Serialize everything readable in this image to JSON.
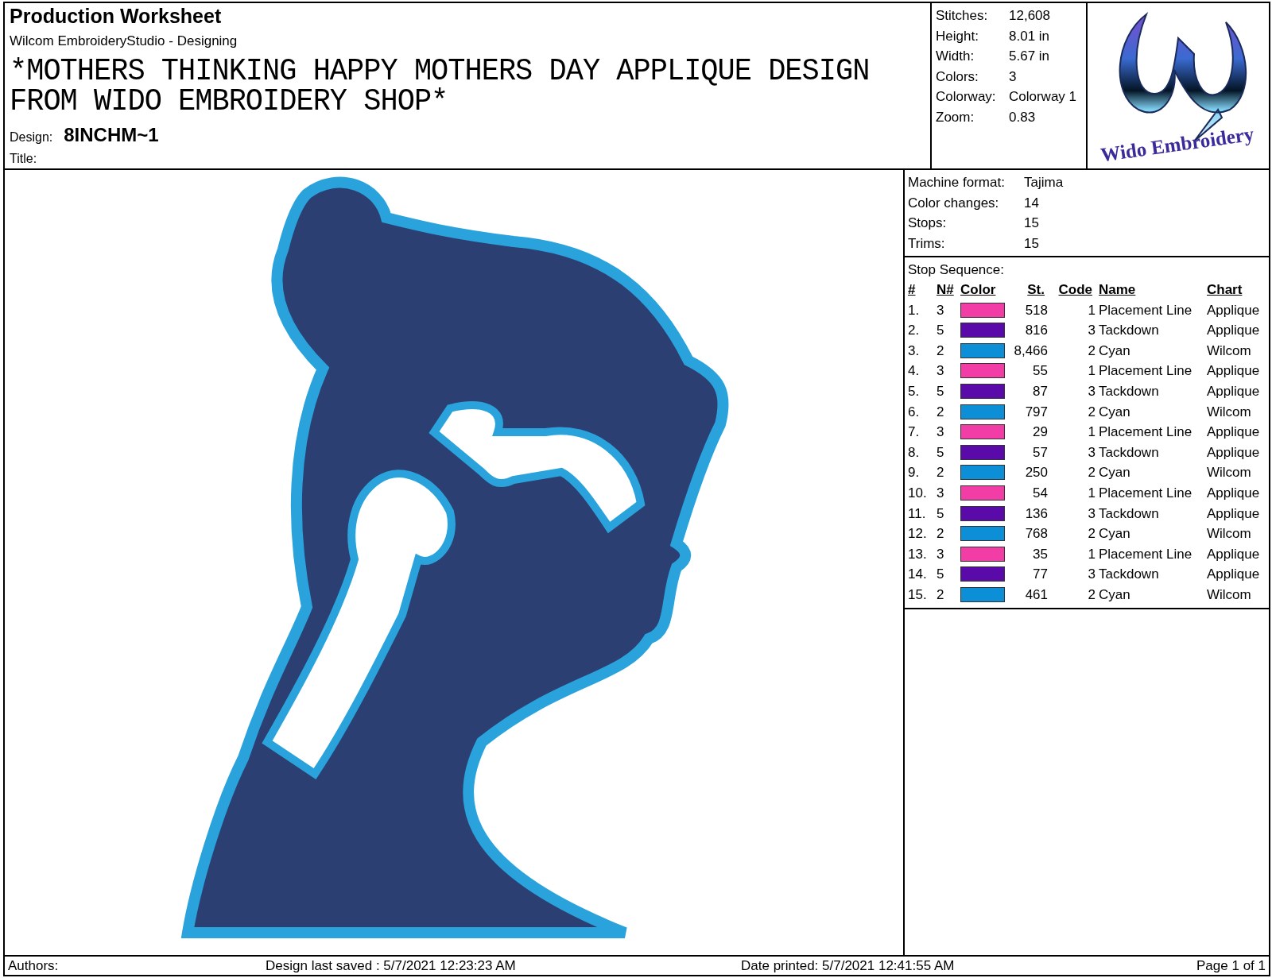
{
  "header": {
    "title": "Production Worksheet",
    "subtitle": "Wilcom EmbroideryStudio - Designing",
    "design_description": "*MOTHERS THINKING HAPPY MOTHERS DAY APPLIQUE DESIGN FROM WIDO EMBROIDERY SHOP*",
    "design_label": "Design:",
    "design_value": "8INCHM~1",
    "title_label": "Title:"
  },
  "stats": [
    {
      "label": "Stitches:",
      "value": "12,608"
    },
    {
      "label": "Height:",
      "value": "8.01 in"
    },
    {
      "label": "Width:",
      "value": "5.67 in"
    },
    {
      "label": "Colors:",
      "value": "3"
    },
    {
      "label": "Colorway:",
      "value": "Colorway 1"
    },
    {
      "label": "Zoom:",
      "value": "0.83"
    }
  ],
  "logo": {
    "text": "Wido Embroidery"
  },
  "machine": [
    {
      "label": "Machine format:",
      "value": "Tajima"
    },
    {
      "label": "Color changes:",
      "value": "14"
    },
    {
      "label": "Stops:",
      "value": "15"
    },
    {
      "label": "Trims:",
      "value": "15"
    }
  ],
  "stop_sequence": {
    "title": "Stop Sequence:",
    "columns": [
      "#",
      "N#",
      "Color",
      "St.",
      "Code",
      "Name",
      "Chart"
    ],
    "rows": [
      {
        "num": "1.",
        "needle": "3",
        "color": "#f23ca6",
        "stitches": "518",
        "code": "1",
        "name": "Placement Line",
        "chart": "Applique"
      },
      {
        "num": "2.",
        "needle": "5",
        "color": "#5a0aa8",
        "stitches": "816",
        "code": "3",
        "name": "Tackdown",
        "chart": "Applique"
      },
      {
        "num": "3.",
        "needle": "2",
        "color": "#0d8fd8",
        "stitches": "8,466",
        "code": "2",
        "name": "Cyan",
        "chart": "Wilcom"
      },
      {
        "num": "4.",
        "needle": "3",
        "color": "#f23ca6",
        "stitches": "55",
        "code": "1",
        "name": "Placement Line",
        "chart": "Applique"
      },
      {
        "num": "5.",
        "needle": "5",
        "color": "#5a0aa8",
        "stitches": "87",
        "code": "3",
        "name": "Tackdown",
        "chart": "Applique"
      },
      {
        "num": "6.",
        "needle": "2",
        "color": "#0d8fd8",
        "stitches": "797",
        "code": "2",
        "name": "Cyan",
        "chart": "Wilcom"
      },
      {
        "num": "7.",
        "needle": "3",
        "color": "#f23ca6",
        "stitches": "29",
        "code": "1",
        "name": "Placement Line",
        "chart": "Applique"
      },
      {
        "num": "8.",
        "needle": "5",
        "color": "#5a0aa8",
        "stitches": "57",
        "code": "3",
        "name": "Tackdown",
        "chart": "Applique"
      },
      {
        "num": "9.",
        "needle": "2",
        "color": "#0d8fd8",
        "stitches": "250",
        "code": "2",
        "name": "Cyan",
        "chart": "Wilcom"
      },
      {
        "num": "10.",
        "needle": "3",
        "color": "#f23ca6",
        "stitches": "54",
        "code": "1",
        "name": "Placement Line",
        "chart": "Applique"
      },
      {
        "num": "11.",
        "needle": "5",
        "color": "#5a0aa8",
        "stitches": "136",
        "code": "3",
        "name": "Tackdown",
        "chart": "Applique"
      },
      {
        "num": "12.",
        "needle": "2",
        "color": "#0d8fd8",
        "stitches": "768",
        "code": "2",
        "name": "Cyan",
        "chart": "Wilcom"
      },
      {
        "num": "13.",
        "needle": "3",
        "color": "#f23ca6",
        "stitches": "35",
        "code": "1",
        "name": "Placement Line",
        "chart": "Applique"
      },
      {
        "num": "14.",
        "needle": "5",
        "color": "#5a0aa8",
        "stitches": "77",
        "code": "3",
        "name": "Tackdown",
        "chart": "Applique"
      },
      {
        "num": "15.",
        "needle": "2",
        "color": "#0d8fd8",
        "stitches": "461",
        "code": "2",
        "name": "Cyan",
        "chart": "Wilcom"
      }
    ]
  },
  "footer": {
    "authors": "Authors:",
    "saved": "Design last saved : 5/7/2021 12:23:23 AM",
    "printed": "Date printed: 5/7/2021 12:41:55 AM",
    "page": "Page 1 of 1"
  }
}
